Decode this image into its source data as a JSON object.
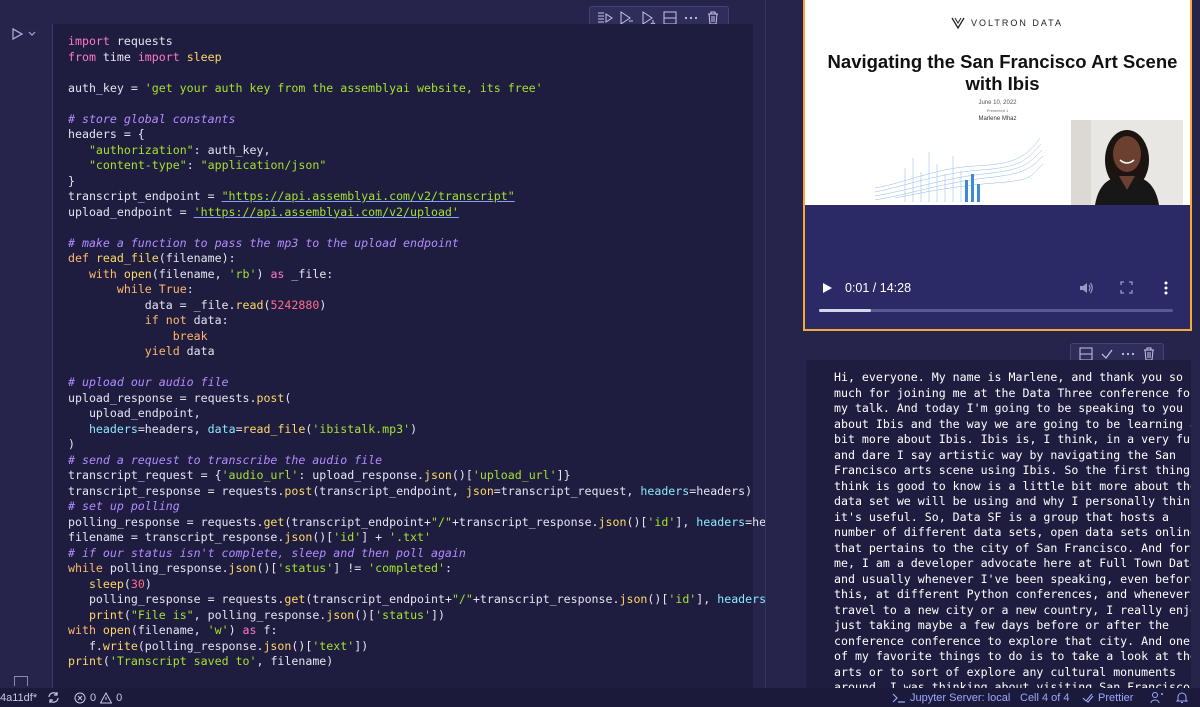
{
  "code_cell": {
    "toolbar": [
      "run-above-icon",
      "run-below-icon",
      "run-cell-icon",
      "split-cell-icon",
      "more-icon",
      "trash-icon"
    ]
  },
  "code_lines": [
    "import requests",
    "from time import sleep",
    "",
    "auth_key = 'get your auth key from the assemblyai website, its free'",
    "",
    "# store global constants",
    "headers = {",
    "   \"authorization\": auth_key,",
    "   \"content-type\": \"application/json\"",
    "}",
    "transcript_endpoint = \"https://api.assemblyai.com/v2/transcript\"",
    "upload_endpoint = 'https://api.assemblyai.com/v2/upload'",
    "",
    "# make a function to pass the mp3 to the upload endpoint",
    "def read_file(filename):",
    "   with open(filename, 'rb') as _file:",
    "       while True:",
    "           data = _file.read(5242880)",
    "           if not data:",
    "               break",
    "           yield data",
    "",
    "# upload our audio file",
    "upload_response = requests.post(",
    "   upload_endpoint,",
    "   headers=headers, data=read_file('ibistalk.mp3')",
    ")",
    "# send a request to transcribe the audio file",
    "transcript_request = {'audio_url': upload_response.json()['upload_url']}",
    "transcript_response = requests.post(transcript_endpoint, json=transcript_request, headers=headers)",
    "# set up polling",
    "polling_response = requests.get(transcript_endpoint+\"/\"+transcript_response.json()['id'], headers=headers)",
    "filename = transcript_response.json()['id'] + '.txt'",
    "# if our status isn't complete, sleep and then poll again",
    "while polling_response.json()['status'] != 'completed':",
    "   sleep(30)",
    "   polling_response = requests.get(transcript_endpoint+\"/\"+transcript_response.json()['id'], headers=headers)",
    "   print(\"File is\", polling_response.json()['status'])",
    "with open(filename, 'w') as f:",
    "   f.write(polling_response.json()['text'])",
    "print('Transcript saved to', filename)"
  ],
  "video": {
    "slide_logo": "VOLTRON DATA",
    "slide_title": "Navigating the San Francisco Art Scene with Ibis",
    "slide_date": "June 10, 2022",
    "slide_presented": "Presented 1",
    "slide_author": "Marlene Mhaz",
    "time": "0:01 / 14:28",
    "progress_fraction": 0.0012
  },
  "transcript_lines": [
    "Hi, everyone. My name is Marlene, and thank you so",
    "much for joining me at the Data Three conference for",
    "my talk. And today I'm going to be speaking to you",
    "about Ibis and the way we are going to be learning a",
    "bit more about Ibis. Ibis is, I think, in a very fun",
    "and dare I say artistic way by navigating the San",
    "Francisco arts scene using Ibis. So the first thing I",
    "think is good to know is a little bit more about the",
    "data set we will be using and why I personally think",
    "it's useful. So, Data SF is a group that hosts a",
    "number of different data sets, open data sets online",
    "that pertains to the city of San Francisco. And for",
    "me, I am a developer advocate here at Full Town Data,",
    "and usually whenever I've been speaking, even before",
    "this, at different Python conferences, and whenever I",
    "travel to a new city or a new country, I really enjoy",
    "just taking maybe a few days before or after the",
    "conference conference to explore that city. And one",
    "of my favorite things to do is to take a look at the",
    "arts or to sort of explore any cultural monuments",
    "around. I was thinking about visiting San Francisco"
  ],
  "status_bar": {
    "branch": "4a11df*",
    "errors": "0",
    "warnings": "0",
    "jupyter": "Jupyter Server: local",
    "cell": "Cell 4 of 4",
    "prettier": "Prettier"
  },
  "colors": {
    "accent": "#f4a93c",
    "background": "#26244a",
    "cell_background": "#1e1c3f"
  }
}
